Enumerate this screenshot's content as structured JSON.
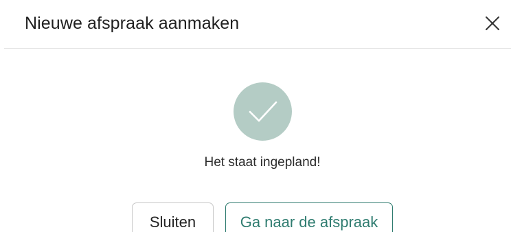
{
  "dialog": {
    "title": "Nieuwe afspraak aanmaken",
    "close_icon": "close-icon",
    "success_icon": "checkmark-icon",
    "message": "Het staat ingepland!",
    "buttons": {
      "close_label": "Sluiten",
      "goto_label": "Ga naar de afspraak"
    }
  },
  "colors": {
    "accent": "#2f7c70",
    "success_circle": "#b4ccc5",
    "divider": "#e4e4e4",
    "secondary_border": "#c8c8c8",
    "text": "#1f1f1f"
  }
}
